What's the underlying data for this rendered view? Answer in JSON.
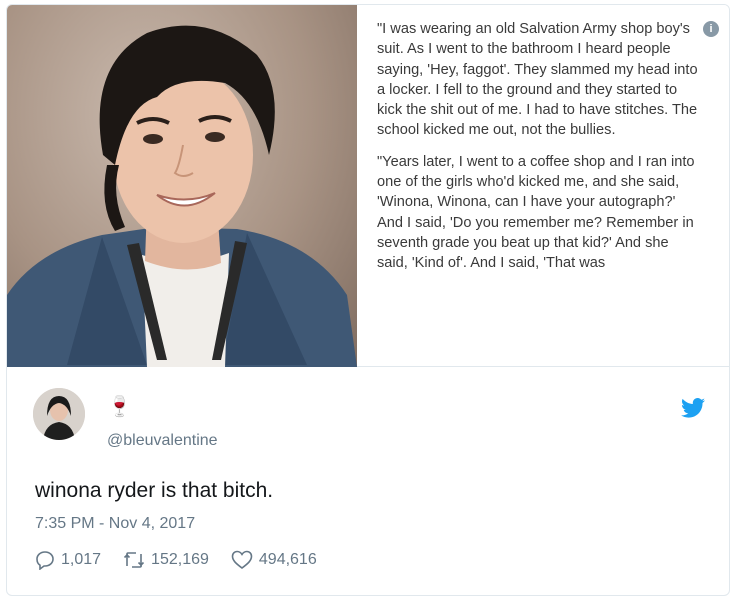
{
  "quote": {
    "paragraph1": "\"I was wearing an old Salvation Army shop boy's suit. As I went to the bathroom I heard people saying, 'Hey, faggot'. They slammed my head into a locker. I fell to the ground and they started to kick the shit out of me. I had to have stitches. The school kicked me out, not the bullies.",
    "paragraph2": "\"Years later, I went to a coffee shop and I ran into one of the girls who'd kicked me, and she said, 'Winona, Winona, can I have your autograph?' And I said, 'Do you remember me? Remember in seventh grade you beat up that kid?' And she said, 'Kind of'. And I said, 'That was"
  },
  "tweet": {
    "display_name_emoji": "🍷",
    "handle": "@bleuvalentine",
    "text": "winona ryder is that bitch.",
    "timestamp": "7:35 PM - Nov 4, 2017"
  },
  "stats": {
    "replies": "1,017",
    "retweets": "152,169",
    "likes": "494,616"
  },
  "colors": {
    "brand": "#1da1f2",
    "muted": "#657786",
    "text": "#14171a"
  },
  "icons": {
    "info": "info-icon",
    "bird": "twitter-bird-icon",
    "reply": "reply-icon",
    "retweet": "retweet-icon",
    "like": "heart-icon"
  }
}
